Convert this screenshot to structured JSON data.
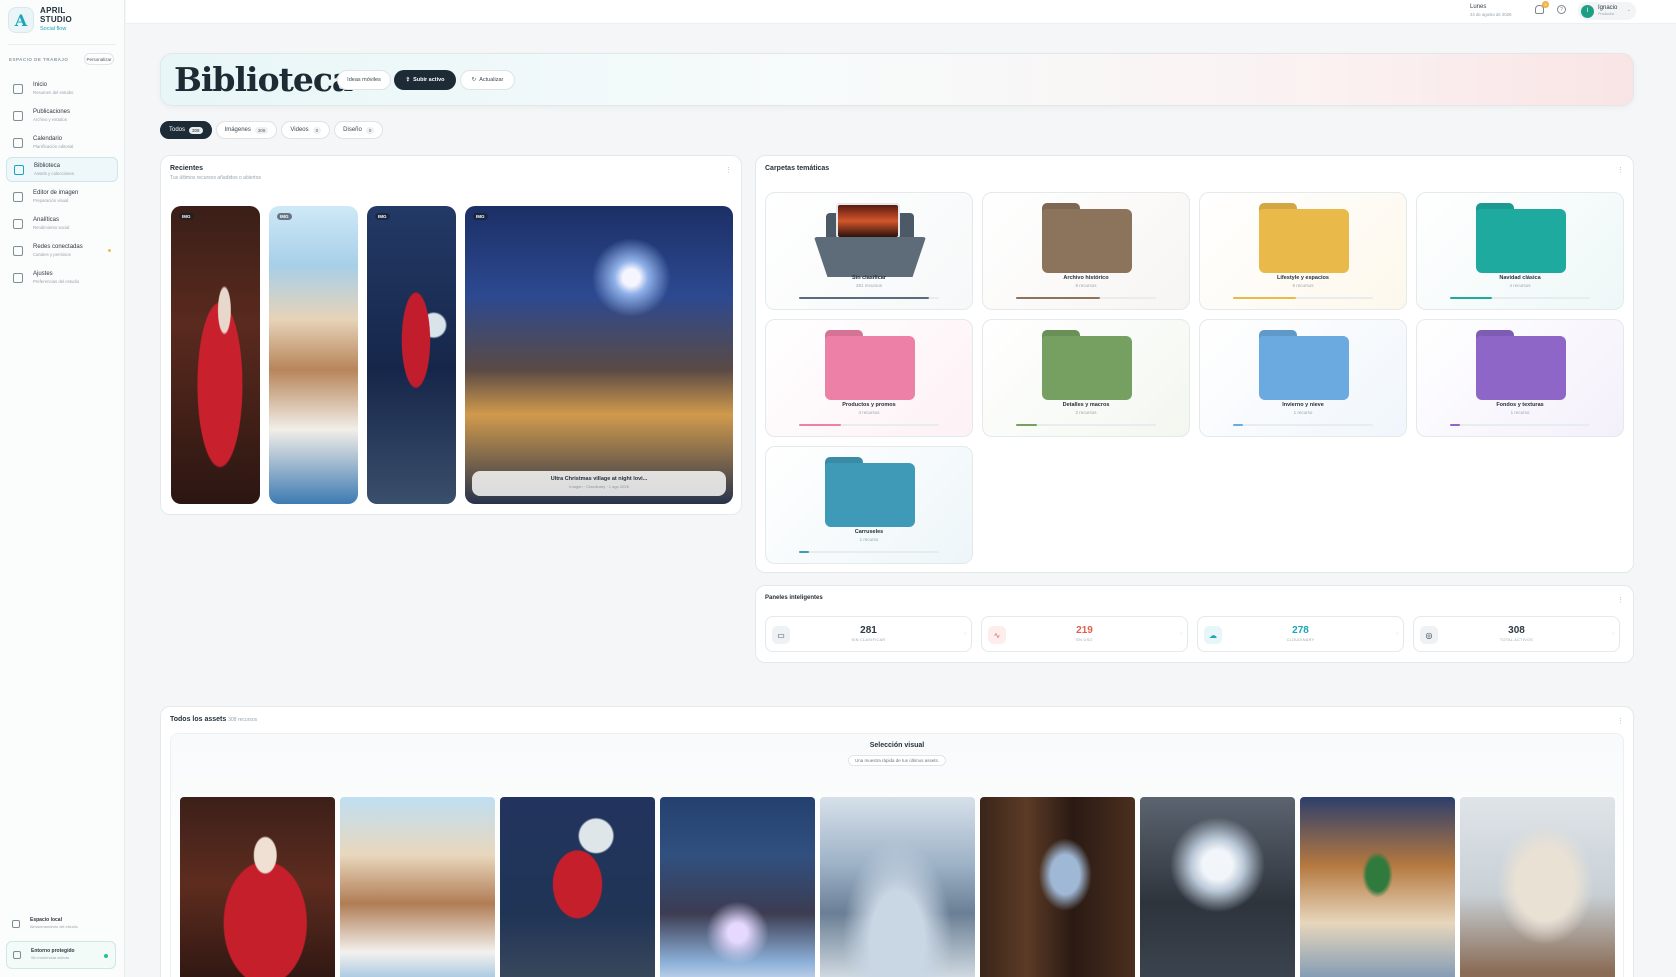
{
  "brand": {
    "title_line1": "APRIL",
    "title_line2": "STUDIO",
    "subtitle": "Social flow",
    "logo_letter": "A"
  },
  "sidebar": {
    "section_label": "ESPACIO DE TRABAJO",
    "customize_label": "Personalizar",
    "items": [
      {
        "label": "Inicio",
        "sub": "Resumen del estudio",
        "icon": "home-icon"
      },
      {
        "label": "Publicaciones",
        "sub": "Archivo y estados",
        "icon": "calendar-icon"
      },
      {
        "label": "Calendario",
        "sub": "Planificación editorial",
        "icon": "calendar-icon"
      },
      {
        "label": "Biblioteca",
        "sub": "Assets y colecciones",
        "icon": "folder-icon",
        "active": true
      },
      {
        "label": "Editor de imagen",
        "sub": "Preparación visual",
        "icon": "image-icon"
      },
      {
        "label": "Analíticas",
        "sub": "Rendimiento social",
        "icon": "chart-icon"
      },
      {
        "label": "Redes conectadas",
        "sub": "Canales y permisos",
        "icon": "share-icon"
      },
      {
        "label": "Ajustes",
        "sub": "Preferencias del estudio",
        "icon": "gear-icon"
      }
    ],
    "local": {
      "label": "Espacio local",
      "sub": "Almacenamiento del estudio"
    },
    "env": {
      "label": "Entorno protegido",
      "sub": "Sin incidencias activas"
    }
  },
  "topbar": {
    "day": "Lunes",
    "date": "24 de agosto de 2026",
    "notif_count": "3",
    "user_name": "Ignacio",
    "user_role": "Productor",
    "user_initial": "I"
  },
  "hero": {
    "title": "Biblioteca",
    "ideas_label": "Ideas móviles",
    "upload_label": "Subir activo",
    "refresh_label": "Actualizar"
  },
  "filters": [
    {
      "label": "Todos",
      "count": "308",
      "active": true
    },
    {
      "label": "Imágenes",
      "count": "308"
    },
    {
      "label": "Videos",
      "count": "0"
    },
    {
      "label": "Diseño",
      "count": "0"
    }
  ],
  "recents": {
    "title": "Recientes",
    "subtitle": "Tus últimos recursos añadidos o abiertos",
    "tag": "IMG",
    "caption_title": "Ultra Christmas village at night lovi...",
    "caption_meta": "Imagen · Cloudinary · 1 ago 2026"
  },
  "folders": {
    "title": "Carpetas temáticas",
    "items": [
      {
        "name": "Sin clasificar",
        "count": "281 recursos",
        "color": "#5d6c78",
        "progress": 0.93
      },
      {
        "name": "Archivo histórico",
        "count": "8 recursos",
        "color": "#8c735c",
        "progress": 0.6
      },
      {
        "name": "Lifestyle y espacios",
        "count": "6 recursos",
        "color": "#e9b94a",
        "progress": 0.45
      },
      {
        "name": "Navidad clásica",
        "count": "4 recursos",
        "color": "#1faaa0",
        "progress": 0.3
      },
      {
        "name": "Productos y promos",
        "count": "4 recursos",
        "color": "#ec80a6",
        "progress": 0.3
      },
      {
        "name": "Detalles y macros",
        "count": "2 recursos",
        "color": "#76a062",
        "progress": 0.15
      },
      {
        "name": "Invierno y nieve",
        "count": "1 recurso",
        "color": "#6aaae0",
        "progress": 0.07
      },
      {
        "name": "Fondos y texturas",
        "count": "1 recurso",
        "color": "#8d66c8",
        "progress": 0.07
      },
      {
        "name": "Carruseles",
        "count": "1 recurso",
        "color": "#3f9ab8",
        "progress": 0.07
      }
    ]
  },
  "smart": {
    "title": "Paneles inteligentes",
    "stats": [
      {
        "value": "281",
        "label": "SIN CLASIFICAR",
        "color": "#2d3a43",
        "icon_bg": "#eef2f4",
        "icon": "folder-icon"
      },
      {
        "value": "219",
        "label": "EN USO",
        "color": "#e0604f",
        "icon_bg": "#fdeeed",
        "icon": "pulse-icon"
      },
      {
        "value": "278",
        "label": "CLOUDINARY",
        "color": "#1aa5b8",
        "icon_bg": "#e7f6f8",
        "icon": "cloud-icon"
      },
      {
        "value": "308",
        "label": "TOTAL ACTIVOS",
        "color": "#2d3a43",
        "icon_bg": "#eef2f4",
        "icon": "target-icon"
      }
    ]
  },
  "assets": {
    "title": "Todos los assets",
    "count": "308 recursos",
    "selection_title": "Selección visual",
    "selection_sub": "Una muestra rápida de tus últimos assets."
  }
}
